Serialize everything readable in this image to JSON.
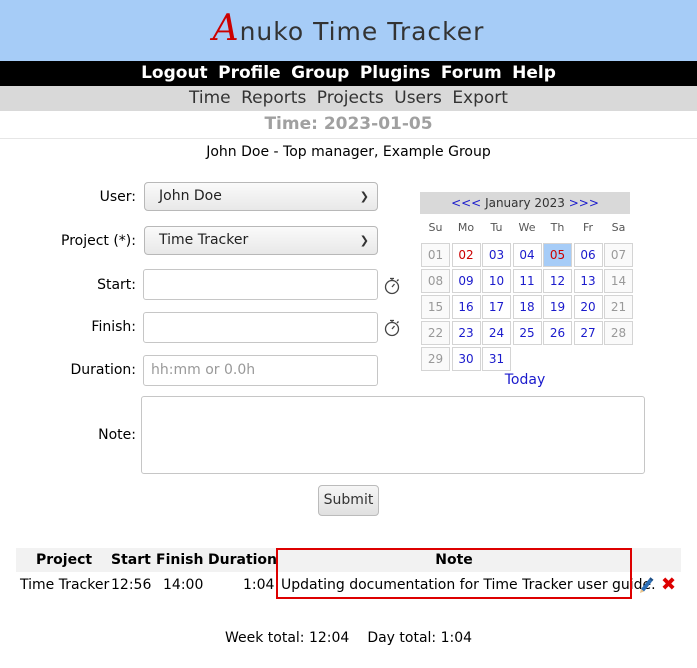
{
  "app": {
    "logo_initial": "A",
    "logo_rest": "nuko Time Tracker"
  },
  "top_menu": [
    "Logout",
    "Profile",
    "Group",
    "Plugins",
    "Forum",
    "Help"
  ],
  "sub_menu": [
    "Time",
    "Reports",
    "Projects",
    "Users",
    "Export"
  ],
  "page": {
    "title": "Time: 2023-01-05",
    "user_line": "John Doe - Top manager, Example Group"
  },
  "form": {
    "user_label": "User:",
    "user_value": "John Doe",
    "project_label": "Project (*):",
    "project_value": "Time Tracker",
    "start_label": "Start:",
    "start_value": "",
    "finish_label": "Finish:",
    "finish_value": "",
    "duration_label": "Duration:",
    "duration_placeholder": "hh:mm or 0.0h",
    "note_label": "Note:",
    "note_value": "",
    "submit_label": "Submit"
  },
  "calendar": {
    "prev": "<<<",
    "month": "January 2023",
    "next": ">>>",
    "weekdays": [
      "Su",
      "Mo",
      "Tu",
      "We",
      "Th",
      "Fr",
      "Sa"
    ],
    "weeks": [
      [
        "01",
        "02",
        "03",
        "04",
        "05",
        "06",
        "07"
      ],
      [
        "08",
        "09",
        "10",
        "11",
        "12",
        "13",
        "14"
      ],
      [
        "15",
        "16",
        "17",
        "18",
        "19",
        "20",
        "21"
      ],
      [
        "22",
        "23",
        "24",
        "25",
        "26",
        "27",
        "28"
      ],
      [
        "29",
        "30",
        "31"
      ]
    ],
    "selected_day": "05",
    "holiday_days": [
      "02"
    ],
    "today_link": "Today"
  },
  "entries": {
    "headers": [
      "Project",
      "Start",
      "Finish",
      "Duration",
      "Note"
    ],
    "rows": [
      {
        "project": "Time Tracker",
        "start": "12:56",
        "finish": "14:00",
        "duration": "1:04",
        "note": "Updating documentation for Time Tracker user guide."
      }
    ]
  },
  "totals": {
    "week": "Week total: 12:04",
    "day": "Day total: 1:04"
  },
  "colors": {
    "banner": "#a6ccf7",
    "accent_link": "#1a1acc",
    "highlight_frame": "#dd0000",
    "holiday": "#cc0000"
  },
  "icons": [
    "stopwatch-icon",
    "edit-pencil-icon",
    "delete-x-icon",
    "chevron-down-icon"
  ]
}
